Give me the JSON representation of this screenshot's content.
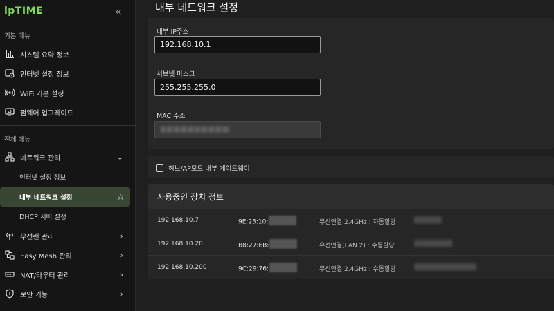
{
  "brand": {
    "name": "ipTIME"
  },
  "sidebar": {
    "collapse_icon": "double-chevron-left-icon",
    "section_basic": "기본 메뉴",
    "basic_items": [
      {
        "label": "시스템 요약 정보",
        "icon": "bar-chart-icon"
      },
      {
        "label": "인터넷 설정 정보",
        "icon": "globe-gear-icon"
      },
      {
        "label": "WiFi 기본 설정",
        "icon": "wifi-icon"
      },
      {
        "label": "펌웨어 업그레이드",
        "icon": "monitor-refresh-icon"
      }
    ],
    "section_all": "전체 메뉴",
    "all_items": [
      {
        "label": "네트워크 관리",
        "icon": "network-icon",
        "expanded": true
      },
      {
        "label": "인터넷 설정 정보",
        "sub": true
      },
      {
        "label": "내부 네트워크 설정",
        "sub": true,
        "active": true
      },
      {
        "label": "DHCP 서버 설정",
        "sub": true
      },
      {
        "label": "무선랜 관리",
        "icon": "wireless-icon"
      },
      {
        "label": "Easy Mesh 관리",
        "icon": "mesh-icon"
      },
      {
        "label": "NAT/라우터 관리",
        "icon": "router-icon"
      },
      {
        "label": "보안 기능",
        "icon": "shield-icon"
      }
    ]
  },
  "main": {
    "title": "내부 네트워크 설정",
    "ip_label": "내부 IP주소",
    "ip_value": "192.168.10.1",
    "subnet_label": "서브넷 마스크",
    "subnet_value": "255.255.255.0",
    "mac_label": "MAC 주소",
    "hub_ap_label": "허브/AP모드 내부 게이트웨이",
    "hub_ap_checked": false
  },
  "devices": {
    "header": "사용중인 장치 정보",
    "rows": [
      {
        "ip": "192.168.10.7",
        "mac": "9E:23:10:",
        "conn": "무선연결 2.4GHz : 자동할당"
      },
      {
        "ip": "192.168.10.20",
        "mac": "B8:27:EB:",
        "conn": "유선연결(LAN 2) : 수동할당"
      },
      {
        "ip": "192.168.10.200",
        "mac": "9C:29:76:",
        "conn": "무선연결 2.4GHz : 수동할당"
      }
    ]
  },
  "colors": {
    "accent": "#7ed957",
    "active_bg": "#3a4634",
    "sidebar_bg": "#151515",
    "main_bg": "#1f1f1f",
    "card_bg": "#262626"
  }
}
